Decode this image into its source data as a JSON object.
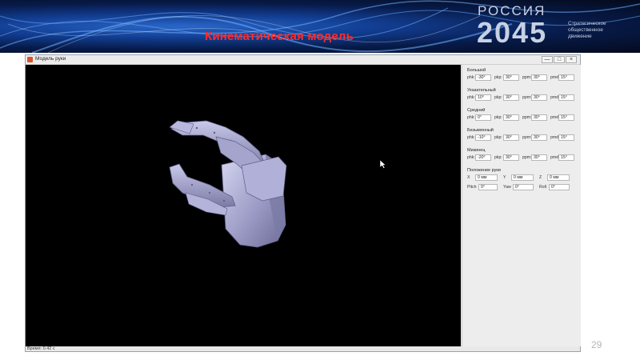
{
  "slide": {
    "title": "Кинематическая модель",
    "page_number": "29",
    "logo": {
      "line1": "РОССИЯ",
      "line2": "2045",
      "tagline": "Стратегическое общественное движение"
    }
  },
  "window": {
    "title": "Модель руки",
    "controls": [
      "—",
      "□",
      "×"
    ],
    "status": "Время: 0.42 с"
  },
  "panel": {
    "fingers": [
      {
        "name": "Большой",
        "fields": [
          {
            "label": "phk:",
            "value": "-30°"
          },
          {
            "label": "pkp:",
            "value": "30°"
          },
          {
            "label": "ppm:",
            "value": "30°"
          },
          {
            "label": "pmd:",
            "value": "15°"
          }
        ]
      },
      {
        "name": "Указательный",
        "fields": [
          {
            "label": "phk:",
            "value": "10°"
          },
          {
            "label": "pkp:",
            "value": "30°"
          },
          {
            "label": "ppm:",
            "value": "30°"
          },
          {
            "label": "pmd:",
            "value": "15°"
          }
        ]
      },
      {
        "name": "Средний",
        "fields": [
          {
            "label": "phk:",
            "value": "0°"
          },
          {
            "label": "pkp:",
            "value": "30°"
          },
          {
            "label": "ppm:",
            "value": "30°"
          },
          {
            "label": "pmd:",
            "value": "15°"
          }
        ]
      },
      {
        "name": "Безымянный",
        "fields": [
          {
            "label": "phk:",
            "value": "-10°"
          },
          {
            "label": "pkp:",
            "value": "30°"
          },
          {
            "label": "ppm:",
            "value": "30°"
          },
          {
            "label": "pmd:",
            "value": "15°"
          }
        ]
      },
      {
        "name": "Мизинец",
        "fields": [
          {
            "label": "phk:",
            "value": "-20°"
          },
          {
            "label": "pkp:",
            "value": "30°"
          },
          {
            "label": "ppm:",
            "value": "30°"
          },
          {
            "label": "pmd:",
            "value": "15°"
          }
        ]
      }
    ],
    "position": {
      "title": "Положение руки",
      "row1": [
        {
          "label": "X",
          "value": "0 мм"
        },
        {
          "label": "Y",
          "value": "0 мм"
        },
        {
          "label": "Z",
          "value": "0 мм"
        }
      ],
      "row2": [
        {
          "label": "Pitch",
          "value": "0°"
        },
        {
          "label": "Yaw",
          "value": "0°"
        },
        {
          "label": "Roll",
          "value": "0°"
        }
      ]
    }
  },
  "colors": {
    "title_red": "#ff2b2b",
    "banner_blue": "#123e93",
    "viewport_bg": "#000000",
    "model_fill": "#8f8fb8"
  }
}
